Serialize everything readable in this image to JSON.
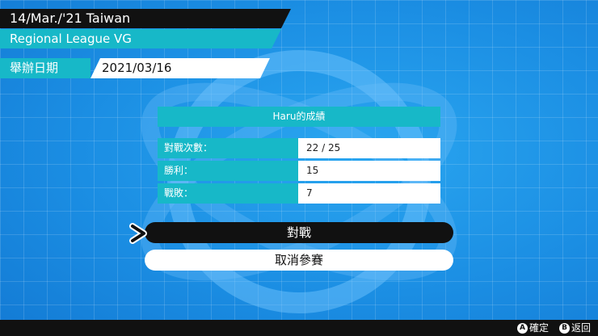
{
  "header": {
    "title": "14/Mar./'21 Taiwan",
    "subtitle": "Regional League VG"
  },
  "date": {
    "label": "舉辦日期",
    "value": "2021/03/16"
  },
  "record": {
    "heading": "Haru的成績",
    "rows": [
      {
        "label": "對戰次數：",
        "value": "22 / 25"
      },
      {
        "label": "勝利：",
        "value": "15"
      },
      {
        "label": "戰敗：",
        "value": "7"
      }
    ]
  },
  "menu": {
    "battle_label": "對戰",
    "cancel_label": "取消參賽"
  },
  "controls": {
    "confirm_key": "A",
    "confirm_label": "確定",
    "back_key": "B",
    "back_label": "返回"
  },
  "colors": {
    "background": "#1a8fe0",
    "accent": "#17b8c8",
    "dark": "#111111"
  }
}
